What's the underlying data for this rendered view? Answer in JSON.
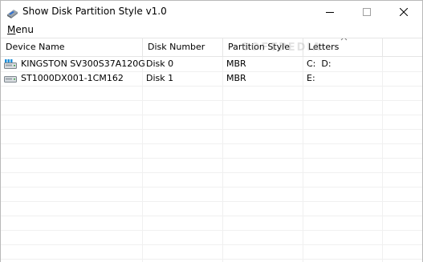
{
  "window": {
    "title": "Show Disk Partition Style v1.0",
    "icon": "app-disk-icon"
  },
  "menu": {
    "label_underlined": "M",
    "label_rest": "enu"
  },
  "columns": [
    {
      "label": "Device Name"
    },
    {
      "label": "Disk Number"
    },
    {
      "label": "Partition Style"
    },
    {
      "label": "Letters",
      "sorted": "ascending"
    }
  ],
  "rows": [
    {
      "icon": "ssd-drive-icon",
      "device": "KINGSTON SV300S37A120G",
      "disk_number": "Disk 0",
      "partition_style": "MBR",
      "letters": "C:  D:"
    },
    {
      "icon": "hard-drive-icon",
      "device": "ST1000DX001-1CM162",
      "disk_number": "Disk 1",
      "partition_style": "MBR",
      "letters": "E:"
    }
  ],
  "watermark": "SOFTPEDIA",
  "colors": {
    "grid": "#f0f0f0",
    "header_divider": "#e5e5e5",
    "window_border": "#b9b9b9"
  }
}
